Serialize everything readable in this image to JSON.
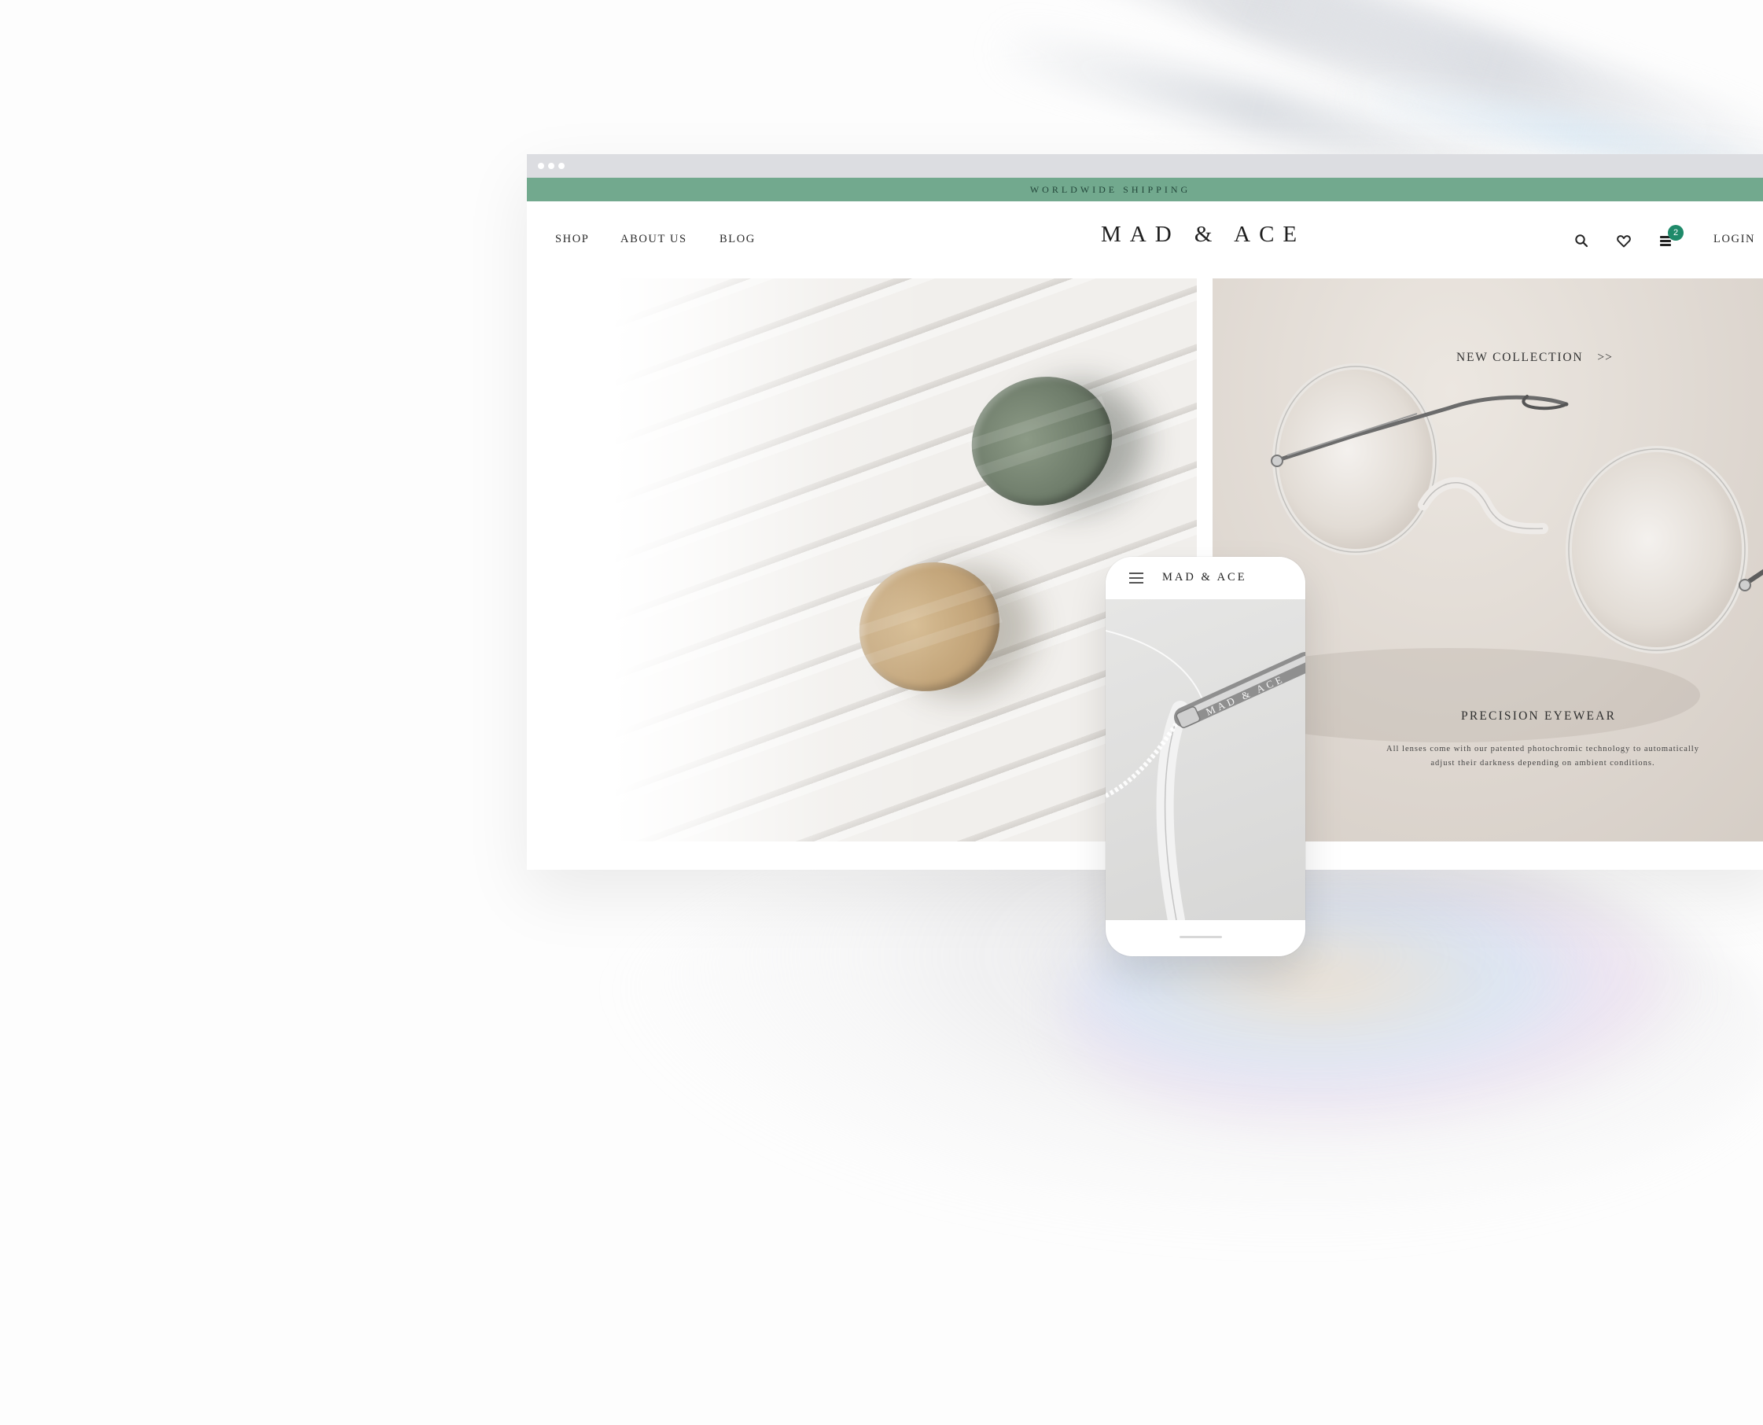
{
  "browser": {
    "window_dots": 3
  },
  "announcement": {
    "text": "WORLDWIDE SHIPPING"
  },
  "nav": {
    "links": [
      "SHOP",
      "ABOUT US",
      "BLOG"
    ],
    "logo": "MAD & ACE",
    "icons": [
      "search-icon",
      "heart-icon",
      "cart-icon"
    ],
    "cart_count": "2",
    "login": "LOGIN"
  },
  "hero": {
    "cta": "NEW COLLECTION",
    "cta_arrows": ">>",
    "feature_title": "PRECISION EYEWEAR",
    "feature_text": "All lenses come with our patented photochromic technology to automatically adjust their darkness depending on ambient conditions."
  },
  "phone": {
    "logo": "MAD & ACE",
    "menu_icon": "hamburger-icon",
    "temple_engraving": "MAD & ACE"
  },
  "colors": {
    "announcement_bg": "#72a98e",
    "announcement_text": "#23463a",
    "badge_bg": "#1f8a6a",
    "chrome_bg": "#dcdde1"
  }
}
